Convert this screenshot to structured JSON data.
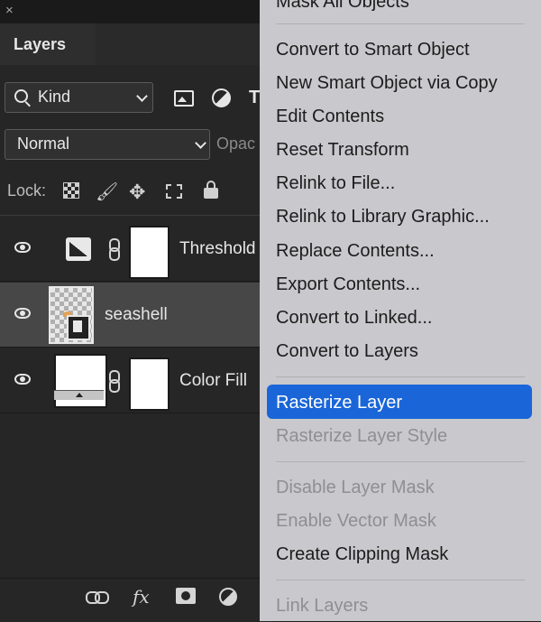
{
  "panel": {
    "close_glyph": "×",
    "tab_label": "Layers",
    "filter": {
      "label": "Kind",
      "icons": [
        "search-icon",
        "image-filter-icon",
        "adjustment-filter-icon",
        "type-filter-icon"
      ]
    },
    "blend_mode": "Normal",
    "opacity_label": "Opac",
    "lock_label": "Lock:",
    "lock_icons": [
      "lock-pixels-icon",
      "brush-icon",
      "move-icon",
      "artboard-icon",
      "lock-all-icon"
    ],
    "layers": [
      {
        "name": "Threshold",
        "selected": false
      },
      {
        "name": "seashell",
        "selected": true
      },
      {
        "name": "Color Fill",
        "selected": false
      }
    ],
    "bottom_icons": [
      "link-icon",
      "fx-icon",
      "mask-icon",
      "adjustment-icon"
    ],
    "fx_label": "fx"
  },
  "menu": {
    "items": [
      {
        "label": "Mask All Objects",
        "enabled": true
      },
      {
        "label": "Convert to Smart Object",
        "enabled": true
      },
      {
        "label": "New Smart Object via Copy",
        "enabled": true
      },
      {
        "label": "Edit Contents",
        "enabled": true
      },
      {
        "label": "Reset Transform",
        "enabled": true
      },
      {
        "label": "Relink to File...",
        "enabled": true
      },
      {
        "label": "Relink to Library Graphic...",
        "enabled": true
      },
      {
        "label": "Replace Contents...",
        "enabled": true
      },
      {
        "label": "Export Contents...",
        "enabled": true
      },
      {
        "label": "Convert to Linked...",
        "enabled": true
      },
      {
        "label": "Convert to Layers",
        "enabled": true
      },
      {
        "label": "Rasterize Layer",
        "enabled": true,
        "highlighted": true
      },
      {
        "label": "Rasterize Layer Style",
        "enabled": false
      },
      {
        "label": "Disable Layer Mask",
        "enabled": false
      },
      {
        "label": "Enable Vector Mask",
        "enabled": false
      },
      {
        "label": "Create Clipping Mask",
        "enabled": true
      },
      {
        "label": "Link Layers",
        "enabled": false
      }
    ],
    "highlight_color": "#1a66d8"
  }
}
